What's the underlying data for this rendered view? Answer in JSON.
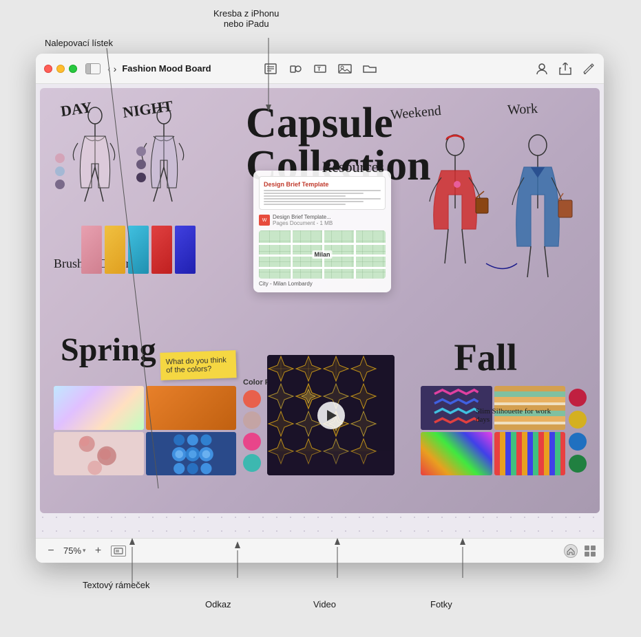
{
  "annotations": {
    "nalepovaci_label": "Nalepovací lístek",
    "kresba_label": "Kresba z iPhonu\nnebo iPadu",
    "textovy_label": "Textový rámeček",
    "odkaz_label": "Odkaz",
    "video_label": "Video",
    "fotky_label": "Fotky"
  },
  "window": {
    "title": "Fashion Mood Board",
    "traffic_lights": [
      "red",
      "yellow",
      "green"
    ],
    "zoom": "75%"
  },
  "toolbar": {
    "sidebar_btn": "sidebar",
    "back": "‹",
    "forward": "›",
    "insert_text": "T",
    "share_btn": "share",
    "collab_btn": "collab",
    "edit_btn": "edit"
  },
  "canvas": {
    "title_handwritten": "Capsule\nCollection",
    "day_label": "DAY",
    "night_label": "NIGHT",
    "spring_label": "Spring",
    "fall_label": "Fall",
    "weekend_label": "Weekend",
    "work_label": "Work",
    "brushed_cotton": "Brushed\nCotton",
    "sticky_note_text": "What do you think of the colors?",
    "resources_label": "Resources",
    "color_palette_label": "Color\nPalette",
    "slim_label": "Slim Silhouette\nfor work days",
    "doc_title": "Design Brief Template",
    "doc_name": "Design Brief Template...",
    "doc_size": "Pages Document - 1 MB",
    "map_city": "Milan",
    "map_region": "City - Milan Lombardy"
  },
  "palette_colors": [
    "#e8604c",
    "#c4a4a4",
    "#e8458a",
    "#3db8b0"
  ],
  "fabric_colors": [
    "#e85d5d",
    "#5d8ae8",
    "#3db86b",
    "#e8b03d",
    "#8e4de8"
  ],
  "statusbar": {
    "zoom_minus": "−",
    "zoom_value": "75%",
    "zoom_plus": "+",
    "zoom_chevron": "▾"
  }
}
